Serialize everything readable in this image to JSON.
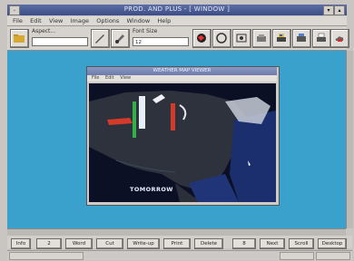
{
  "window": {
    "title": "PROD. AND PLUS - [ WINDOW ]"
  },
  "menu": [
    "File",
    "Edit",
    "View",
    "Image",
    "Options",
    "Window",
    "Help"
  ],
  "toolbar": {
    "field1_label": "Aspect...",
    "field2_label": "Font Size",
    "field2_value": "12"
  },
  "inner_window": {
    "title": "WEATHER MAP VIEWER",
    "menu": [
      "File",
      "Edit",
      "View"
    ],
    "map_label": "TOMORROW"
  },
  "bottom_buttons": [
    "Info",
    "2",
    "Word",
    "Cut",
    "Write-up",
    "Print",
    "Delete",
    "8",
    "Next",
    "Scroll",
    "Desktop"
  ],
  "icons": [
    "folder-icon",
    "draw-icon",
    "paint-icon",
    "globe-icon",
    "pages-icon",
    "tools-icon",
    "hand-icon",
    "printer-icon",
    "printer-alt-icon",
    "document-icon",
    "cloud-icon"
  ],
  "colors": {
    "workspace": "#3aa0cc",
    "titlebar": "#3c4d86",
    "map_land": "#2a2f3a",
    "map_water": "#1a2d6a"
  }
}
